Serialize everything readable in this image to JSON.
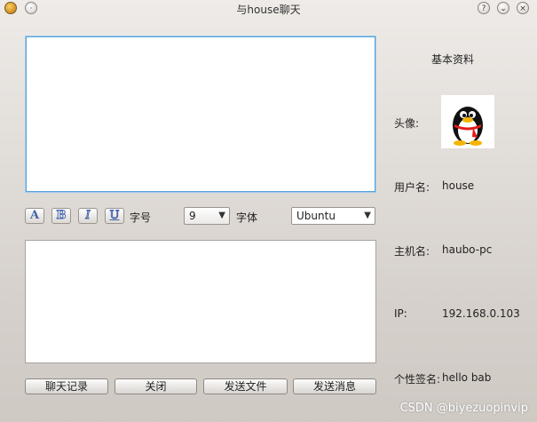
{
  "window": {
    "title": "与house聊天"
  },
  "toolbar": {
    "bold_label": "A",
    "italic_label": "B",
    "underline_label": "I",
    "color_label": "U",
    "font_size_label": "字号",
    "font_size_value": "9",
    "font_label": "字体",
    "font_value": "Ubuntu"
  },
  "buttons": {
    "history": "聊天记录",
    "close": "关闭",
    "send_file": "发送文件",
    "send_message": "发送消息"
  },
  "profile": {
    "header": "基本资料",
    "avatar_label": "头像:",
    "username_label": "用户名:",
    "username": "house",
    "hostname_label": "主机名:",
    "hostname": "haubo-pc",
    "ip_label": "IP:",
    "ip": "192.168.0.103",
    "signature_label": "个性签名:",
    "signature": "hello bab"
  },
  "watermark": "CSDN @biyezuopinvip"
}
